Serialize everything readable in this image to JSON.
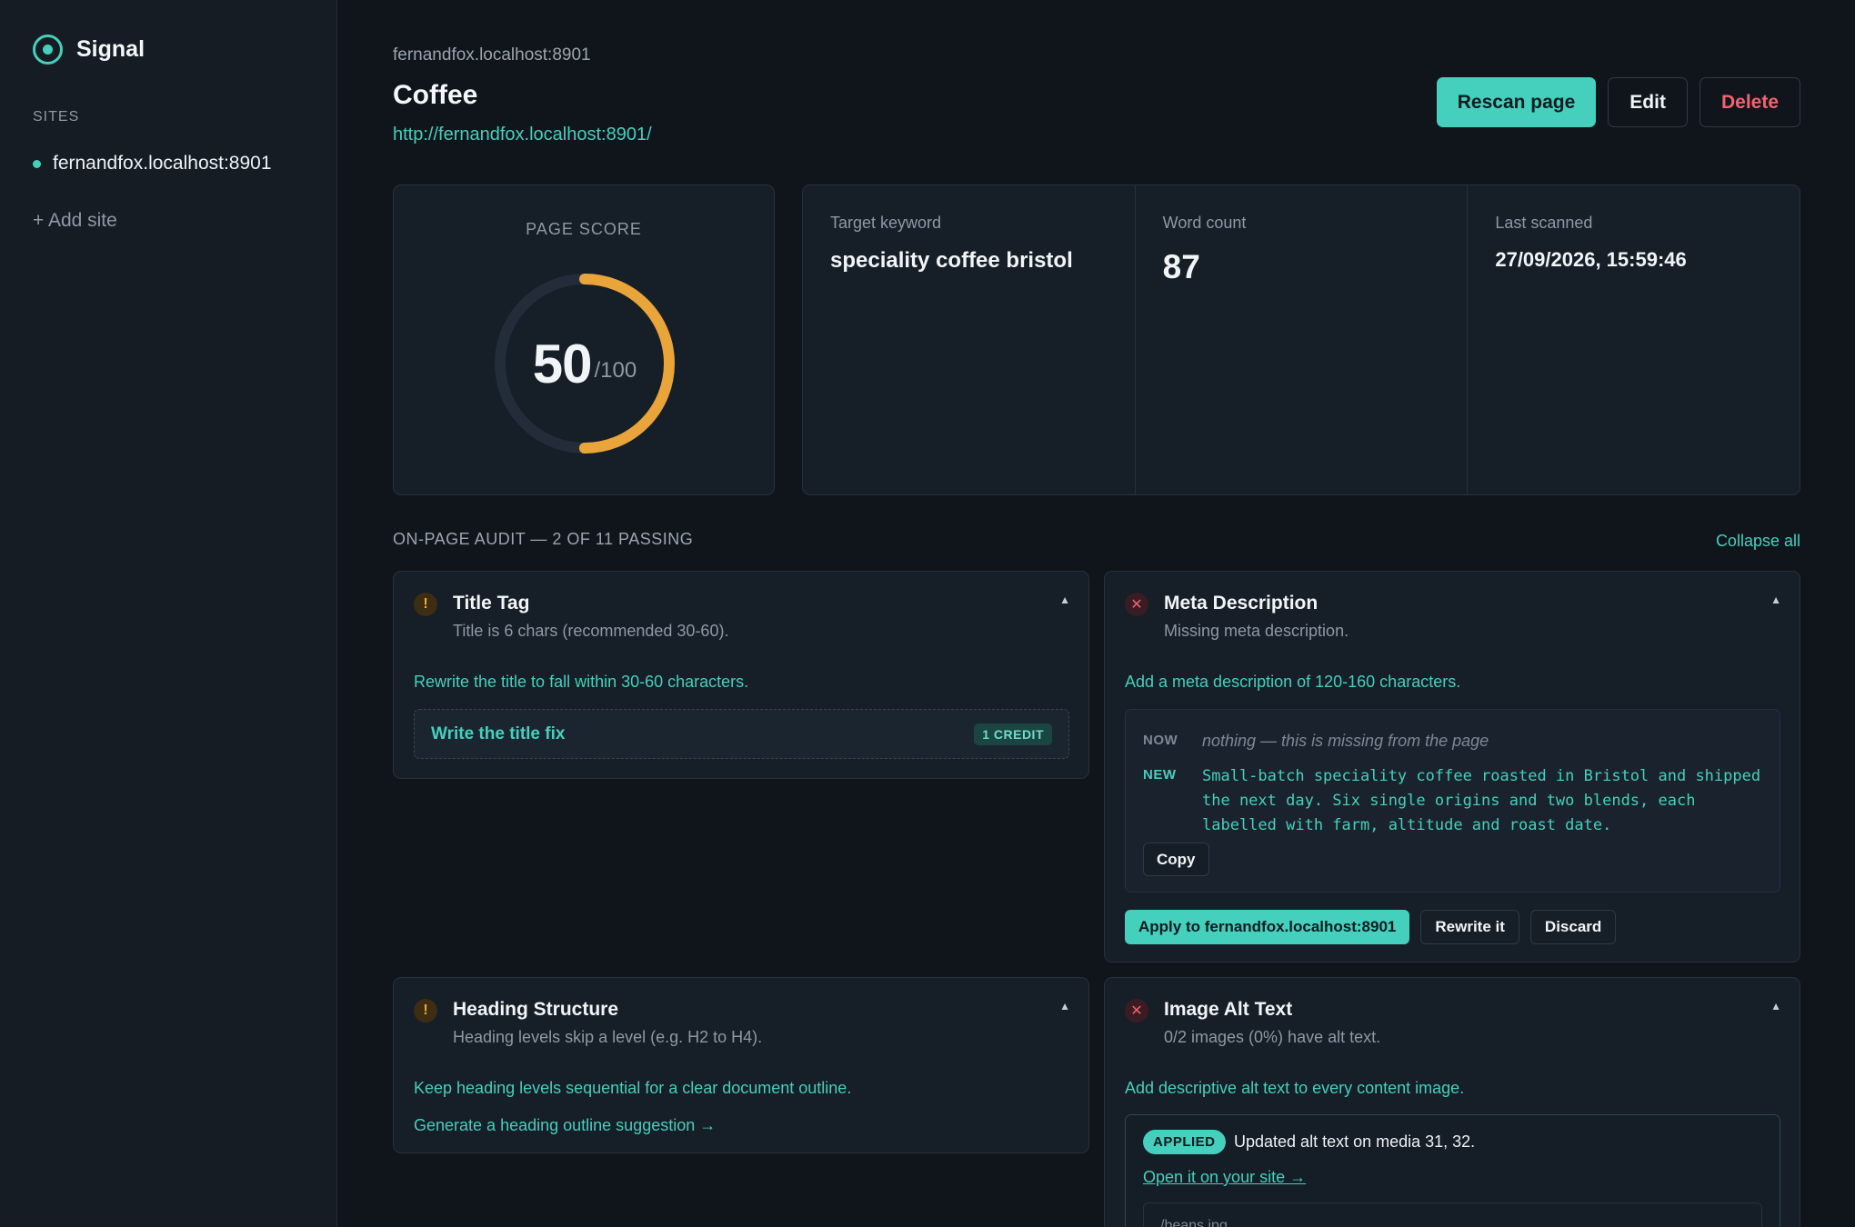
{
  "sidebar": {
    "brand": "Signal",
    "section_label": "SITES",
    "sites": [
      "fernandfox.localhost:8901"
    ],
    "add_site": "+ Add site"
  },
  "header": {
    "breadcrumb": "fernandfox.localhost:8901",
    "title": "Coffee",
    "url": "http://fernandfox.localhost:8901/",
    "rescan": "Rescan page",
    "edit": "Edit",
    "delete": "Delete"
  },
  "score": {
    "label": "PAGE SCORE",
    "value": "50",
    "max": "/100",
    "fraction": 0.5
  },
  "stats": {
    "keyword_label": "Target keyword",
    "keyword": "speciality coffee bristol",
    "word_count_label": "Word count",
    "word_count": "87",
    "last_scanned_label": "Last scanned",
    "last_scanned": "27/09/2026, 15:59:46"
  },
  "audit": {
    "heading": "ON-PAGE AUDIT — 2 OF 11 PASSING",
    "collapse": "Collapse all",
    "title_tag": {
      "title": "Title Tag",
      "status_icon": "!",
      "summary": "Title is 6 chars (recommended 30-60).",
      "fix": "Rewrite the title to fall within 30-60 characters.",
      "action": "Write the title fix",
      "credit": "1 CREDIT"
    },
    "meta": {
      "title": "Meta Description",
      "status_icon": "✕",
      "summary": "Missing meta description.",
      "fix": "Add a meta description of 120-160 characters.",
      "now_label": "NOW",
      "now_value": "nothing — this is missing from the page",
      "new_label": "NEW",
      "new_value": "Small-batch speciality coffee roasted in Bristol and shipped the next day. Six single origins and two blends, each labelled with farm, altitude and roast date.",
      "copy": "Copy",
      "apply": "Apply to fernandfox.localhost:8901",
      "rewrite": "Rewrite it",
      "discard": "Discard"
    },
    "headings": {
      "title": "Heading Structure",
      "status_icon": "!",
      "summary": "Heading levels skip a level (e.g. H2 to H4).",
      "fix": "Keep heading levels sequential for a clear document outline.",
      "link": "Generate a heading outline suggestion →"
    },
    "alt": {
      "title": "Image Alt Text",
      "status_icon": "✕",
      "summary": "0/2 images (0%) have alt text.",
      "fix": "Add descriptive alt text to every content image.",
      "badge": "APPLIED",
      "message": "Updated alt text on media 31, 32.",
      "link": "Open it on your site →",
      "partial": "/beans.jpg"
    }
  },
  "colors": {
    "accent": "#45cfbd",
    "warning": "#f0a93a",
    "danger": "#f0636f",
    "background": "#10151b"
  }
}
